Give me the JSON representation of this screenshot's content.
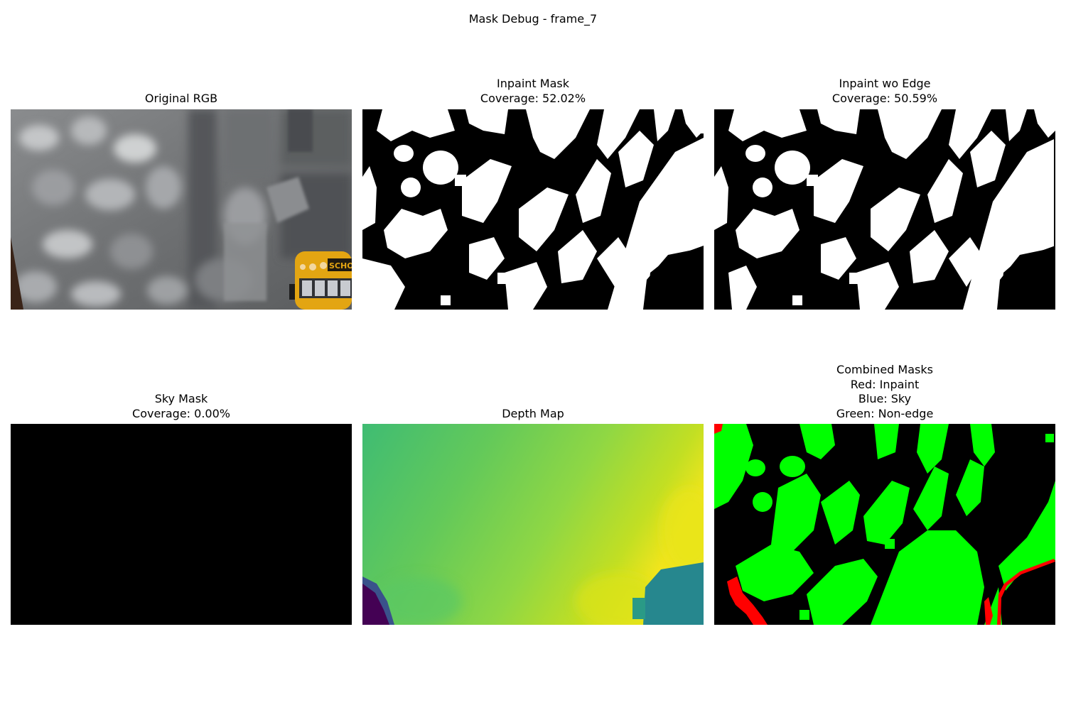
{
  "figure": {
    "title": "Mask Debug - frame_7"
  },
  "panels": [
    {
      "id": "original_rgb",
      "title": "Original RGB"
    },
    {
      "id": "inpaint_mask",
      "title": "Inpaint Mask\nCoverage: 52.02%",
      "coverage": "52.02%"
    },
    {
      "id": "inpaint_wo_edge",
      "title": "Inpaint wo Edge\nCoverage: 50.59%",
      "coverage": "50.59%"
    },
    {
      "id": "sky_mask",
      "title": "Sky Mask\nCoverage: 0.00%",
      "coverage": "0.00%"
    },
    {
      "id": "depth_map",
      "title": "Depth Map"
    },
    {
      "id": "combined_masks",
      "title": "Combined Masks\nRed: Inpaint\nBlue: Sky\nGreen: Non-edge"
    }
  ],
  "images": {
    "original_rgb": {
      "sign_text": "SCHOOL",
      "colors": {
        "base": "#7c7e80",
        "dark": "#3b3c3e",
        "light": "#c9cbcc",
        "bus_yellow": "#e3a512",
        "corner": "#3a2418"
      }
    },
    "inpaint_mask": {
      "colors": {
        "mask": "#ffffff",
        "background": "#000000"
      }
    },
    "inpaint_wo_edge": {
      "colors": {
        "mask": "#ffffff",
        "background": "#000000"
      }
    },
    "sky_mask": {
      "colors": {
        "background": "#000000"
      }
    },
    "depth_map": {
      "colormap": "viridis",
      "colors": {
        "left": "#3fbc73",
        "mid": "#8fd744",
        "right": "#d8e219",
        "far_right": "#f1e51d",
        "near_dark": "#440154",
        "near_blue": "#3a528b",
        "teal": "#26878e"
      }
    },
    "combined_masks": {
      "colors": {
        "inpaint": "#ff0000",
        "sky": "#0000ff",
        "non_edge": "#00ff00",
        "background": "#000000"
      }
    }
  }
}
